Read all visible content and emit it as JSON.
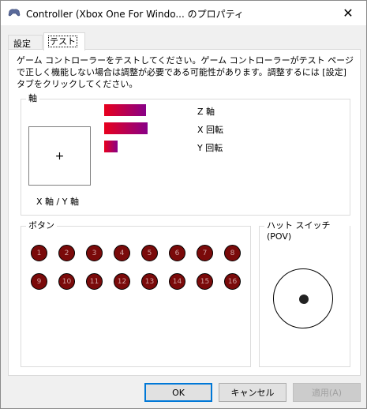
{
  "window": {
    "title": "Controller (Xbox One For Windo... のプロパティ",
    "close_glyph": "✕"
  },
  "tabs": [
    {
      "label": "設定",
      "active": false
    },
    {
      "label": "テスト",
      "active": true
    }
  ],
  "description": "ゲーム コントローラーをテストしてください。ゲーム コントローラーがテスト ページで正しく機能しない場合は調整が必要である可能性があります。調整するには [設定] タブをクリックしてください。",
  "axes_group": {
    "legend": "軸",
    "xy_label": "X 軸 / Y 軸",
    "crosshair": "+",
    "bars": [
      {
        "label": "Z 軸",
        "fill_fraction": 0.97
      },
      {
        "label": "X 回転",
        "fill_fraction": 1.0
      },
      {
        "label": "Y 回転",
        "fill_fraction": 0.3
      }
    ]
  },
  "buttons_group": {
    "legend": "ボタン",
    "buttons": [
      "1",
      "2",
      "3",
      "4",
      "5",
      "6",
      "7",
      "8",
      "9",
      "10",
      "11",
      "12",
      "13",
      "14",
      "15",
      "16"
    ]
  },
  "pov_group": {
    "legend": "ハット スイッチ (POV)"
  },
  "dialog_buttons": {
    "ok": "OK",
    "cancel": "キャンセル",
    "apply": "適用(A)"
  },
  "colors": {
    "bar_start": "#e8001c",
    "bar_end": "#880088",
    "button_fill": "#7a0a0a",
    "default_button_border": "#0078d7"
  }
}
